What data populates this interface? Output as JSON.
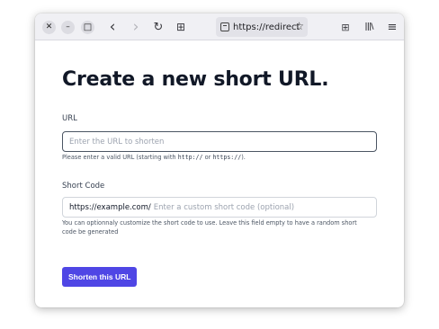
{
  "browser": {
    "url_text": "https://redirectic",
    "controls": {
      "close_glyph": "✕",
      "minimize_glyph": "–",
      "maximize_glyph": "□"
    },
    "icons": {
      "back": "‹",
      "forward": "›",
      "reload": "↻",
      "new_tab": "⊞",
      "star": "☆",
      "extensions": "⊞",
      "library": "|||\\",
      "menu": "≡"
    }
  },
  "page": {
    "title": "Create a new short URL.",
    "url_field": {
      "label": "URL",
      "placeholder": "Enter the URL to shorten",
      "help_prefix": "Please enter a valid URL (starting with ",
      "help_code_1": "http://",
      "help_mid": " or ",
      "help_code_2": "https://",
      "help_suffix": ")."
    },
    "code_field": {
      "label": "Short Code",
      "prefix": "https://example.com/",
      "placeholder": "Enter a custom short code (optional)",
      "help": "You can optionnaly customize the short code to use. Leave this field empty to have a random short code be generated"
    },
    "submit_label": "Shorten this URL"
  },
  "colors": {
    "accent": "#4f46e5",
    "toolbar_bg": "#f0f0f4",
    "title": "#111827"
  }
}
